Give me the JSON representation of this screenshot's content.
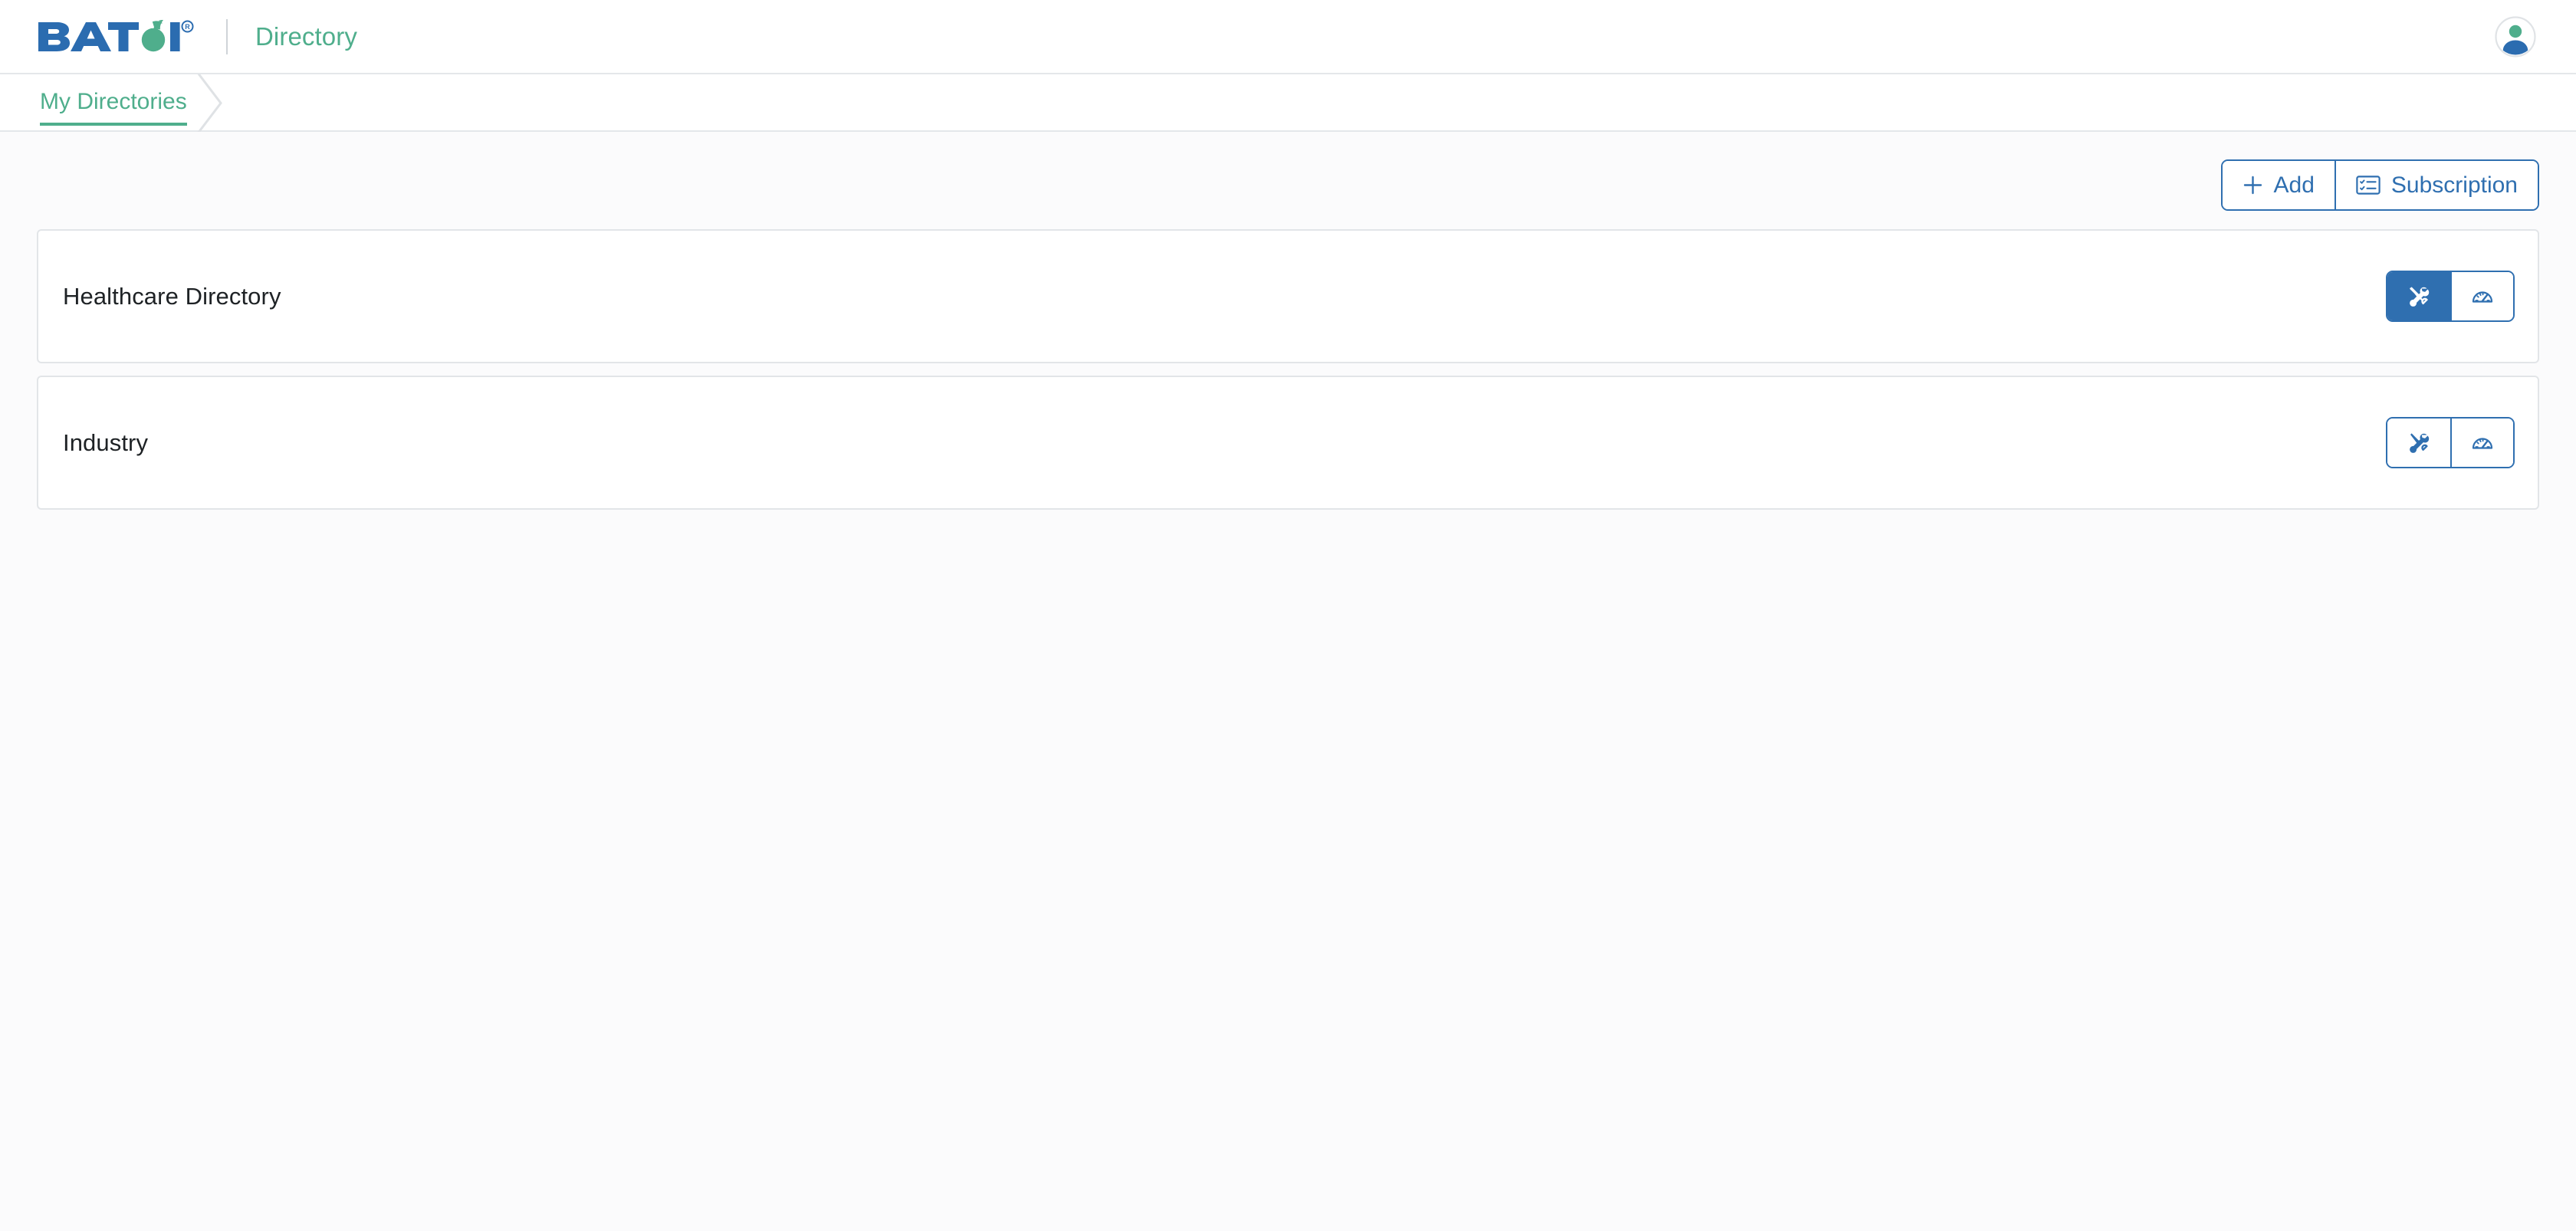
{
  "header": {
    "logo_text": "BATOI",
    "logo_trademark": "®",
    "app_name": "Directory",
    "avatar_name": "user-avatar"
  },
  "breadcrumb": {
    "items": [
      {
        "label": "My Directories",
        "active": true
      }
    ]
  },
  "toolbar": {
    "add_label": "Add",
    "subscription_label": "Subscription"
  },
  "directories": [
    {
      "name": "Healthcare Directory",
      "actions": [
        {
          "icon": "tools-icon",
          "active": true
        },
        {
          "icon": "speedometer-icon",
          "active": false
        }
      ]
    },
    {
      "name": "Industry",
      "actions": [
        {
          "icon": "tools-icon",
          "active": false
        },
        {
          "icon": "speedometer-icon",
          "active": false
        }
      ]
    }
  ],
  "colors": {
    "brand_blue": "#2f6fb0",
    "brand_green": "#4fae8c",
    "logo_blue": "#2b6cb0",
    "border_gray": "#e2e5e8",
    "page_bg": "#fbfbfc",
    "text_dark": "#1e2225"
  }
}
